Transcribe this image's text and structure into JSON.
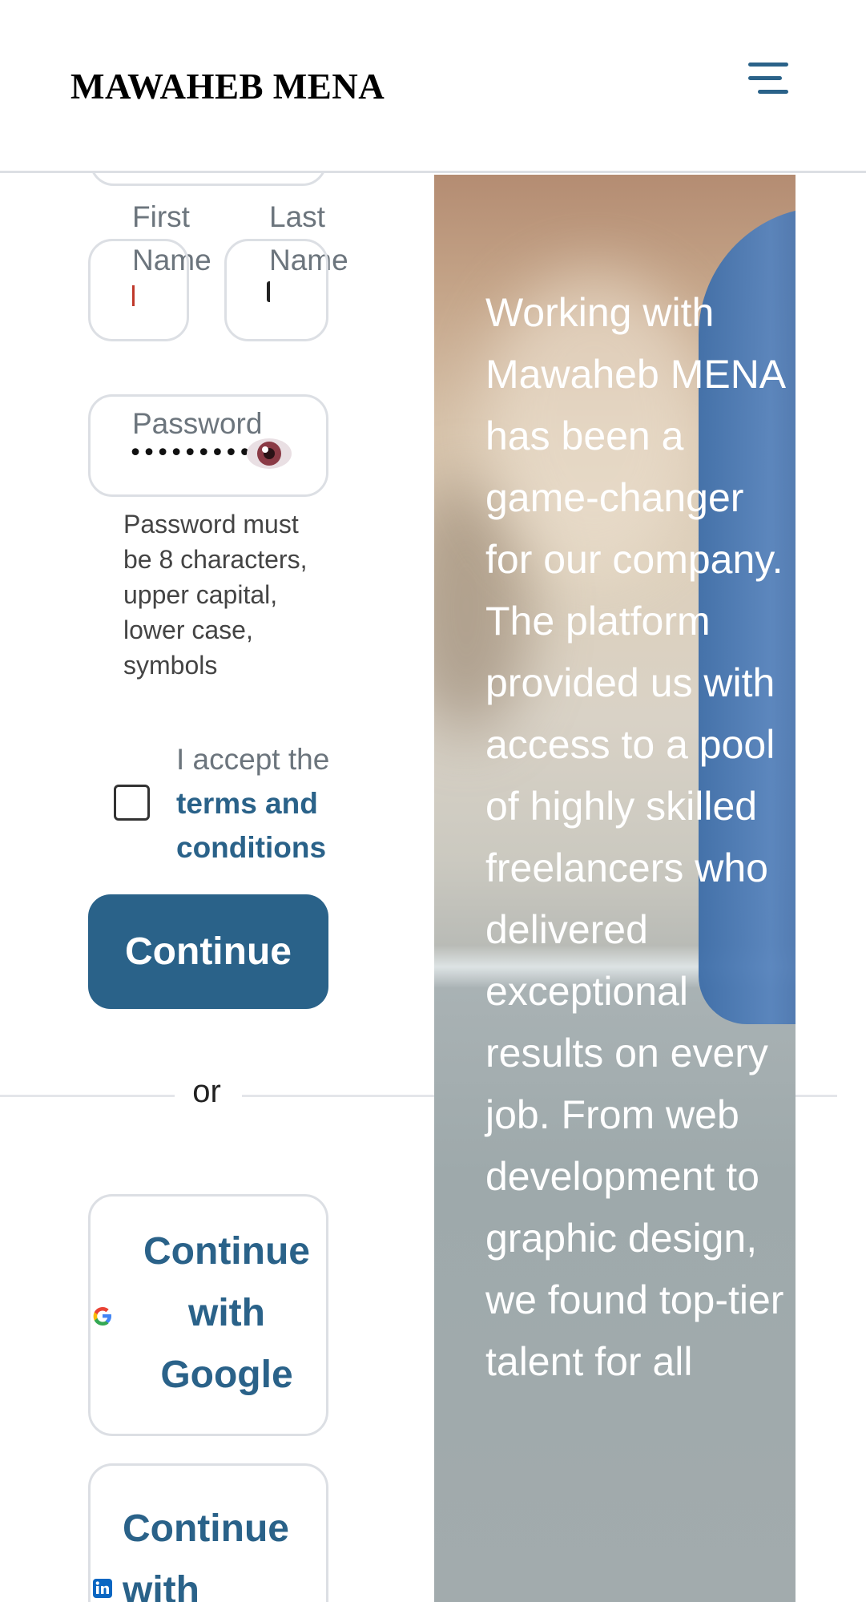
{
  "header": {
    "logo": "MAWAHEB MENA",
    "menu_icon": "hamburger-menu-icon"
  },
  "form": {
    "first_name_label": "First Name",
    "first_name_value": "",
    "last_name_label": "Last Name",
    "last_name_value": "",
    "password_label": "Password",
    "password_mask": "••••••••••",
    "password_toggle_icon": "eye-icon",
    "password_help": "Password must be 8 characters, upper capital, lower case, symbols",
    "terms_prefix": "I accept the",
    "terms_link": "terms and conditions",
    "terms_checked": false,
    "continue_label": "Continue",
    "divider_text": "or"
  },
  "social": {
    "google_label": "Continue with Google",
    "google_icon": "google-icon",
    "linkedin_label": "Continue with",
    "linkedin_icon": "linkedin-icon"
  },
  "testimonial": {
    "text": "Working with Mawaheb MENA has been a game-changer for our company. The platform provided us with access to a pool of highly skilled freelancers who delivered exceptional results on every job. From web development to graphic design, we found top-tier talent for all"
  },
  "colors": {
    "brand": "#2a6289",
    "border": "#dcdfe4"
  }
}
